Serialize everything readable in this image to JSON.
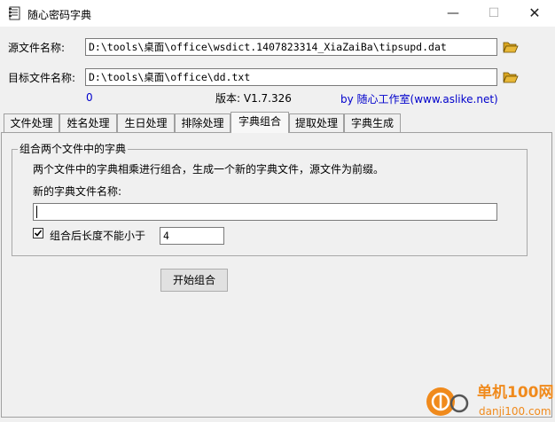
{
  "window": {
    "title": "随心密码字典",
    "min_glyph": "—",
    "max_glyph": "☐",
    "close_glyph": "✕"
  },
  "source": {
    "label": "源文件名称:",
    "value": "D:\\tools\\桌面\\office\\wsdict.1407823314_XiaZaiBa\\tipsupd.dat"
  },
  "target": {
    "label": "目标文件名称:",
    "value": "D:\\tools\\桌面\\office\\dd.txt"
  },
  "status": {
    "count": "0",
    "version": "版本: V1.7.326",
    "credit": "by 随心工作室(www.aslike.net)"
  },
  "tabs": [
    "文件处理",
    "姓名处理",
    "生日处理",
    "排除处理",
    "字典组合",
    "提取处理",
    "字典生成"
  ],
  "combine": {
    "group_title": "组合两个文件中的字典",
    "description": "两个文件中的字典相乘进行组合，生成一个新的字典文件，源文件为前缀。",
    "new_file_label": "新的字典文件名称:",
    "new_file_value": "",
    "min_length_label": "组合后长度不能小于",
    "min_length_checked": true,
    "min_length_value": "4",
    "start_button": "开始组合"
  },
  "watermark": {
    "brand": "单机100网",
    "url": "danji100.com"
  },
  "colors": {
    "accent_blue": "#0000cc",
    "folder_yellow": "#e8b838",
    "watermark_orange": "#f08a1c"
  }
}
